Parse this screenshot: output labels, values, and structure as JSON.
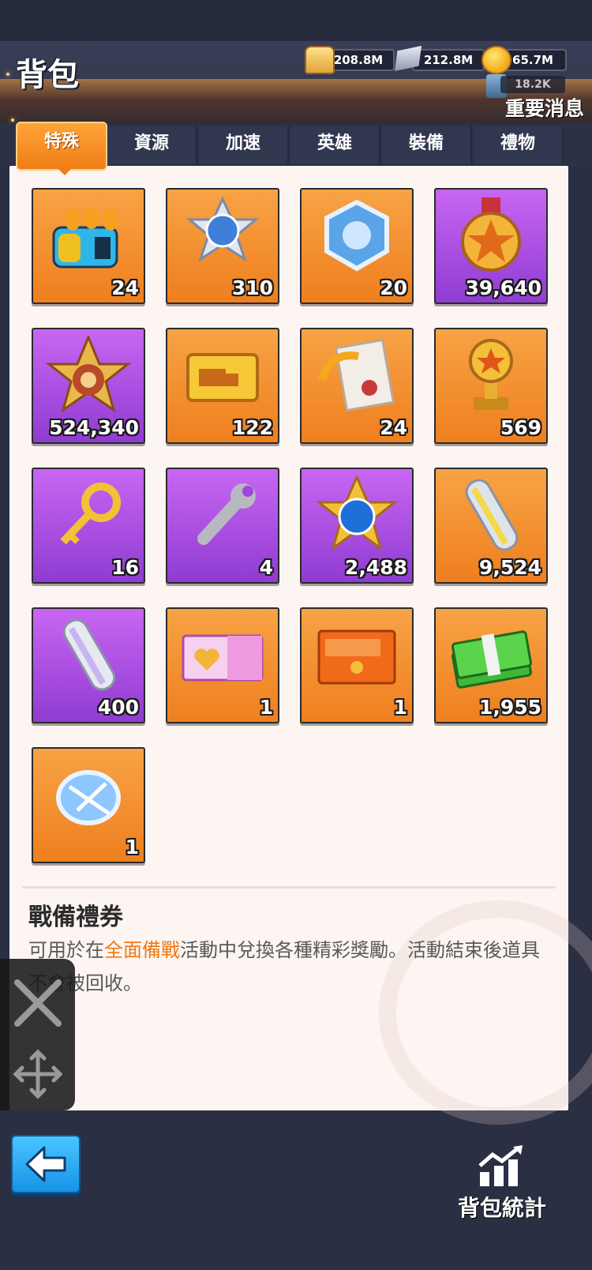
{
  "header": {
    "title": "背包",
    "notice": "重要消息"
  },
  "resources": {
    "food": "208.8M",
    "steel": "212.8M",
    "gold": "65.7M",
    "oil": "18.2K"
  },
  "tabs": [
    {
      "label": "特殊",
      "active": true
    },
    {
      "label": "資源",
      "active": false
    },
    {
      "label": "加速",
      "active": false
    },
    {
      "label": "英雄",
      "active": false
    },
    {
      "label": "裝備",
      "active": false
    },
    {
      "label": "禮物",
      "active": false
    }
  ],
  "items": [
    {
      "qty": "24",
      "bg": "orange",
      "icon": "missile-launcher-icon"
    },
    {
      "qty": "310",
      "bg": "orange",
      "icon": "blue-star-badge-icon"
    },
    {
      "qty": "20",
      "bg": "orange",
      "icon": "hexagon-shield-badge-icon"
    },
    {
      "qty": "39,640",
      "bg": "purple",
      "icon": "star-medal-icon"
    },
    {
      "qty": "524,340",
      "bg": "purple",
      "icon": "star-emblem-icon"
    },
    {
      "qty": "122",
      "bg": "orange",
      "icon": "truck-ticket-icon"
    },
    {
      "qty": "24",
      "bg": "orange",
      "icon": "document-refresh-icon"
    },
    {
      "qty": "569",
      "bg": "orange",
      "icon": "trophy-icon"
    },
    {
      "qty": "16",
      "bg": "purple",
      "icon": "gold-key-icon"
    },
    {
      "qty": "4",
      "bg": "purple",
      "icon": "wrench-icon"
    },
    {
      "qty": "2,488",
      "bg": "purple",
      "icon": "gold-star-blue-gem-icon"
    },
    {
      "qty": "9,524",
      "bg": "orange",
      "icon": "steel-bar-icon"
    },
    {
      "qty": "400",
      "bg": "purple",
      "icon": "silver-bar-icon"
    },
    {
      "qty": "1",
      "bg": "orange",
      "icon": "heart-crown-card-icon"
    },
    {
      "qty": "1",
      "bg": "orange",
      "icon": "red-envelope-2025-icon"
    },
    {
      "qty": "1,955",
      "bg": "orange",
      "icon": "cash-stack-icon"
    },
    {
      "qty": "1",
      "bg": "orange",
      "icon": "blueprint-scroll-icon"
    }
  ],
  "description": {
    "title": "戰備禮券",
    "text_before": "可用於在",
    "highlight": "全面備戰",
    "text_after": "活動中兌換各種精彩獎勵。活動結束後道具不會被回收。"
  },
  "footer": {
    "stats_label": "背包統計"
  },
  "colors": {
    "accent_orange": "#ef7d16",
    "highlight_text": "#ef7a14",
    "back_button": "#1793e6"
  }
}
